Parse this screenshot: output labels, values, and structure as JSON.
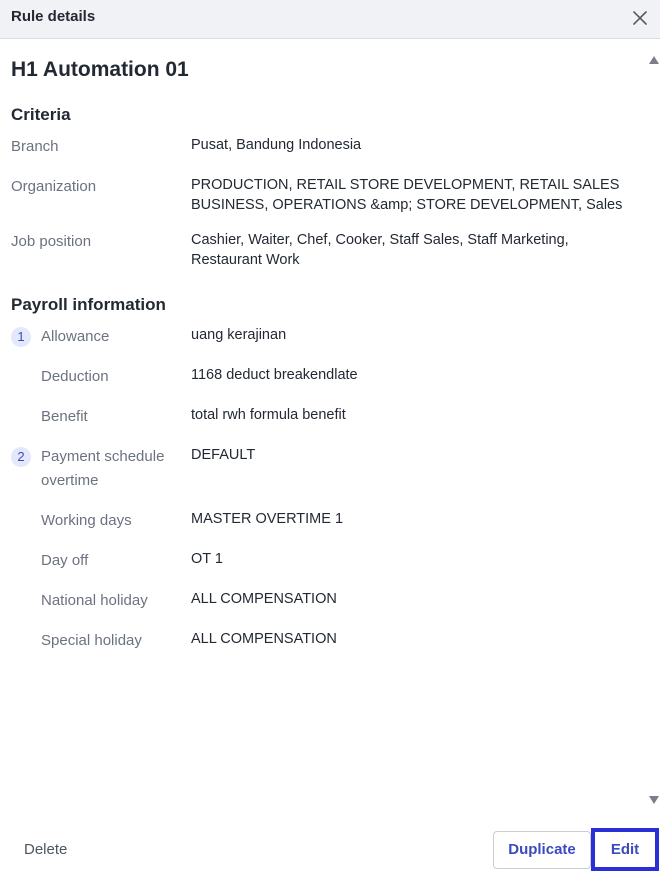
{
  "header": {
    "title": "Rule details",
    "close_icon": "close-icon"
  },
  "rule": {
    "name": "H1 Automation 01"
  },
  "criteria": {
    "title": "Criteria",
    "rows": [
      {
        "label": "Branch",
        "value": "Pusat, Bandung Indonesia"
      },
      {
        "label": "Organization",
        "value_line1": "PRODUCTION, RETAIL STORE DEVELOPMENT, RETAIL SALES",
        "value_line2": "BUSINESS, OPERATIONS &amp; STORE DEVELOPMENT, Sales"
      },
      {
        "label": "Job position",
        "value_line1": "Cashier, Waiter, Chef, Cooker, Staff Sales, Staff Marketing,",
        "value_line2": "Restaurant Work"
      }
    ]
  },
  "payroll": {
    "title": "Payroll information",
    "group1": {
      "step": "1",
      "rows": [
        {
          "label": "Allowance",
          "value": "uang kerajinan"
        },
        {
          "label": "Deduction",
          "value": "1168 deduct breakendlate"
        },
        {
          "label": "Benefit",
          "value": "total rwh formula benefit"
        }
      ]
    },
    "group2": {
      "step": "2",
      "rows": [
        {
          "label_line1": "Payment schedule",
          "label_line2": "overtime",
          "value": "DEFAULT"
        },
        {
          "label": "Working days",
          "value": "MASTER OVERTIME 1"
        },
        {
          "label": "Day off",
          "value": "OT 1"
        },
        {
          "label": "National holiday",
          "value": "ALL COMPENSATION"
        },
        {
          "label": "Special holiday",
          "value": "ALL COMPENSATION"
        }
      ]
    }
  },
  "footer": {
    "delete_label": "Delete",
    "duplicate_label": "Duplicate",
    "edit_label": "Edit"
  },
  "colors": {
    "accent": "#3b4bbf",
    "highlight_border": "#2b2fd6",
    "header_bg": "#f1f2f5"
  }
}
